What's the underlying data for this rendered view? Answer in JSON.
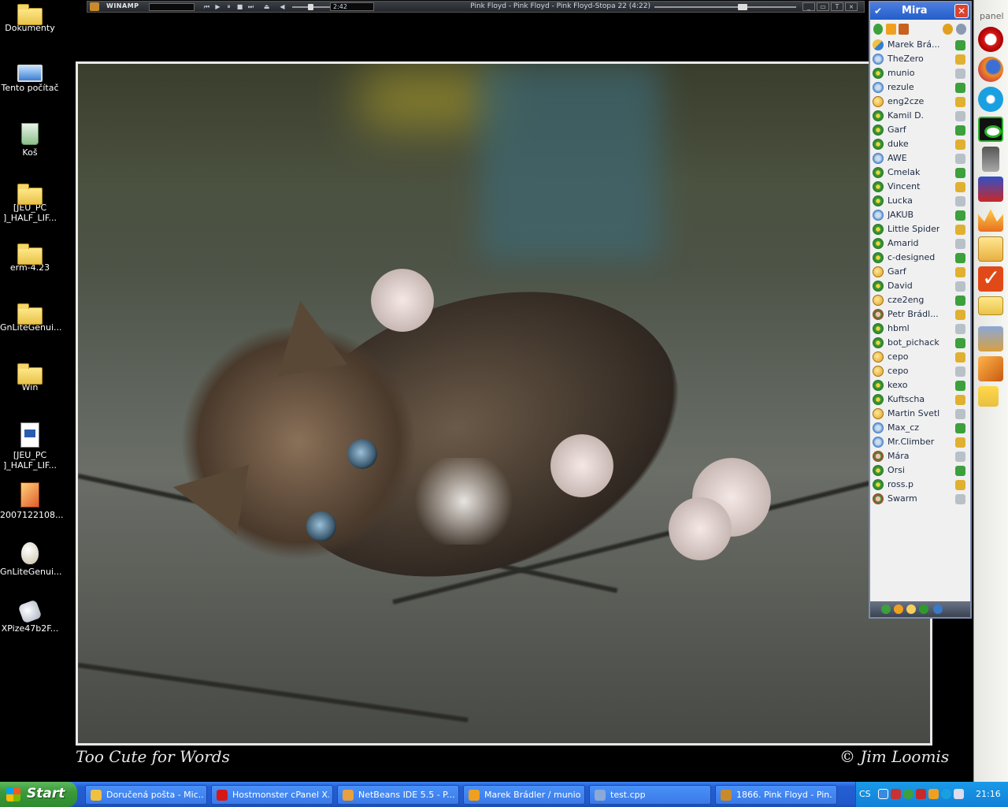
{
  "desktop": {
    "icons": [
      {
        "label": "Dokumenty",
        "icon": "folder-documents-icon"
      },
      {
        "label": "Tento počítač",
        "icon": "my-computer-icon"
      },
      {
        "label": "Koš",
        "icon": "recycle-bin-icon"
      },
      {
        "label": "[JEU_PC\n]_HALF_LIF...",
        "icon": "folder-icon"
      },
      {
        "label": "erm-4.23",
        "icon": "folder-icon"
      },
      {
        "label": "GnLiteGenui...",
        "icon": "folder-icon"
      },
      {
        "label": "Win",
        "icon": "folder-icon"
      },
      {
        "label": "[JEU_PC\n]_HALF_LIF...",
        "icon": "document-icon"
      },
      {
        "label": "2007122108...",
        "icon": "image-file-icon"
      },
      {
        "label": "GnLiteGenui...",
        "icon": "7z-archive-icon"
      },
      {
        "label": "XPize47b2F...",
        "icon": "setup-icon"
      }
    ]
  },
  "winamp": {
    "brand": "WINAMP",
    "time": "2:42",
    "title": "Pink Floyd - Pink Floyd - Pink Floyd-Stopa 22 (4:22)",
    "seek_fraction": 0.59,
    "volume_fraction": 0.42
  },
  "wallpaper": {
    "caption_left": "Too Cute for Words",
    "caption_right": "© Jim Loomis"
  },
  "miranda": {
    "title": "Mira",
    "contacts": [
      {
        "name": "Marek Brá...",
        "status": "mix"
      },
      {
        "name": "TheZero",
        "status": "msn"
      },
      {
        "name": "munio",
        "status": "icq"
      },
      {
        "name": "rezule",
        "status": "msn"
      },
      {
        "name": "eng2cze",
        "status": "jab"
      },
      {
        "name": "Kamil D.",
        "status": "icq"
      },
      {
        "name": "Garf",
        "status": "icq"
      },
      {
        "name": "duke",
        "status": "icq"
      },
      {
        "name": "AWE",
        "status": "msn"
      },
      {
        "name": "Cmelak",
        "status": "icq"
      },
      {
        "name": "Vincent",
        "status": "icq"
      },
      {
        "name": "Lucka",
        "status": "icq"
      },
      {
        "name": "JAKUB",
        "status": "msn"
      },
      {
        "name": "Little Spider",
        "status": "icq"
      },
      {
        "name": "Amarid",
        "status": "icq"
      },
      {
        "name": "c-designed",
        "status": "icq"
      },
      {
        "name": "Garf",
        "status": "jab"
      },
      {
        "name": "David",
        "status": "icq"
      },
      {
        "name": "cze2eng",
        "status": "jab"
      },
      {
        "name": "Petr Brádl...",
        "status": "gg"
      },
      {
        "name": "hbml",
        "status": "icq"
      },
      {
        "name": "bot_pichacky",
        "status": "icq"
      },
      {
        "name": "cepo",
        "status": "jab"
      },
      {
        "name": "cepo",
        "status": "jab"
      },
      {
        "name": "kexo",
        "status": "icq"
      },
      {
        "name": "Kuftscha",
        "status": "icq"
      },
      {
        "name": "Martin Svetlik",
        "status": "jab"
      },
      {
        "name": "Max_cz",
        "status": "msn"
      },
      {
        "name": "Mr.Climber",
        "status": "msn"
      },
      {
        "name": "Mára",
        "status": "gg"
      },
      {
        "name": "Orsi",
        "status": "icq"
      },
      {
        "name": "ross.p",
        "status": "icq"
      },
      {
        "name": "Swarm",
        "status": "gg"
      }
    ]
  },
  "side_panel": {
    "label": "panel",
    "items": [
      "opera-icon",
      "firefox-icon",
      "skype-icon",
      "eye-monitor-icon",
      "flash-drive-icon",
      "floppy-save-icon",
      "crown-icon",
      "notepad-icon",
      "checkmark-icon",
      "folder-icon",
      "keys-icon",
      "box-icon",
      "tree-icon"
    ]
  },
  "taskbar": {
    "start_label": "Start",
    "tasks": [
      {
        "label": "Doručená pošta - Mic...",
        "icon": "outlook-icon",
        "color": "#f0c040"
      },
      {
        "label": "Hostmonster cPanel X...",
        "icon": "opera-icon",
        "color": "#d41818"
      },
      {
        "label": "NetBeans IDE 5.5 - P...",
        "icon": "netbeans-icon",
        "color": "#e8a040"
      },
      {
        "label": "Marek Brádler / munio...",
        "icon": "miranda-icon",
        "color": "#f0a020"
      },
      {
        "label": "test.cpp",
        "icon": "file-icon",
        "color": "#8aa8d8"
      },
      {
        "label": "1866. Pink Floyd - Pin...",
        "icon": "winamp-icon",
        "color": "#c98a2c"
      }
    ],
    "tray": {
      "lang": "CS",
      "clock": "21:16"
    }
  }
}
